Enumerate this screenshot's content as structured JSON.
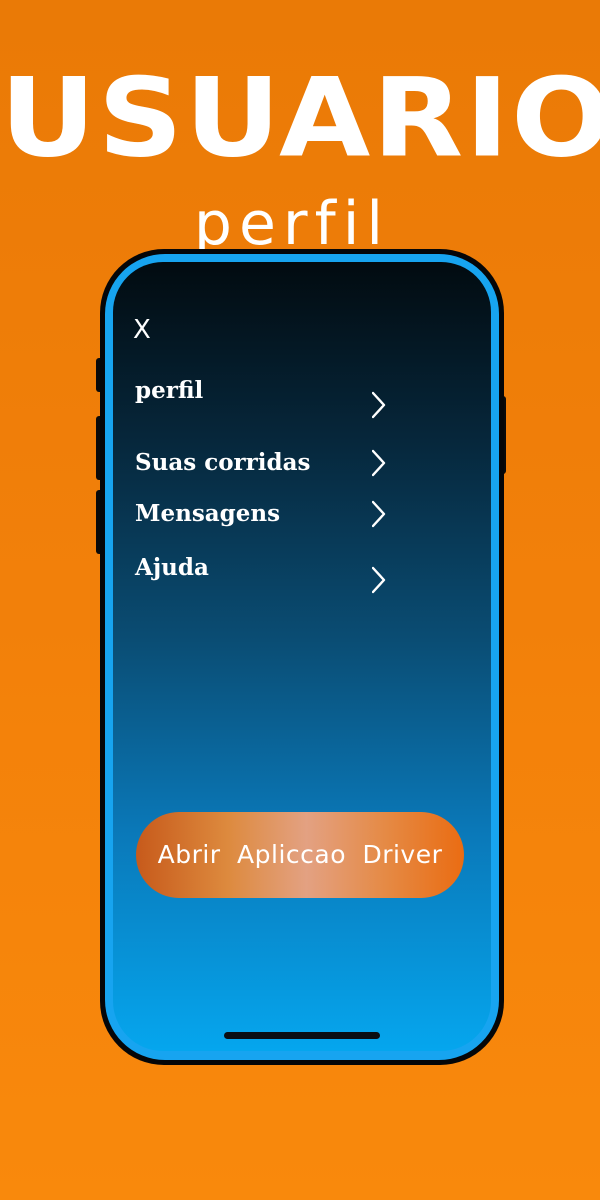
{
  "hero": {
    "title": "USUARIO",
    "subtitle": "perfil"
  },
  "menu": {
    "close_label": "X",
    "items": [
      {
        "label": "perfil",
        "icon": "chevron-right-icon"
      },
      {
        "label": "Suas corridas",
        "icon": "chevron-right-icon"
      },
      {
        "label": "Mensagens",
        "icon": "chevron-right-icon"
      },
      {
        "label": "Ajuda",
        "icon": "chevron-right-icon"
      }
    ]
  },
  "cta": {
    "label": "Abrir Apliccao Driver"
  },
  "colors": {
    "background": "#f2800a",
    "phone_frame": "#050608",
    "phone_rim": "#17a4f0",
    "screen_top": "#020b10",
    "screen_bottom": "#05a6ee",
    "text": "#ffffff"
  }
}
